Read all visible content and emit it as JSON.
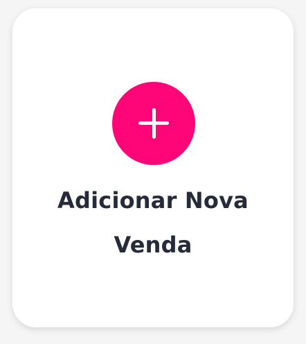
{
  "card": {
    "title_line1": "Adicionar Nova",
    "title_line2": "Venda",
    "icon": "plus-icon",
    "accent_color": "#ff0678",
    "text_color": "#262b3a"
  }
}
